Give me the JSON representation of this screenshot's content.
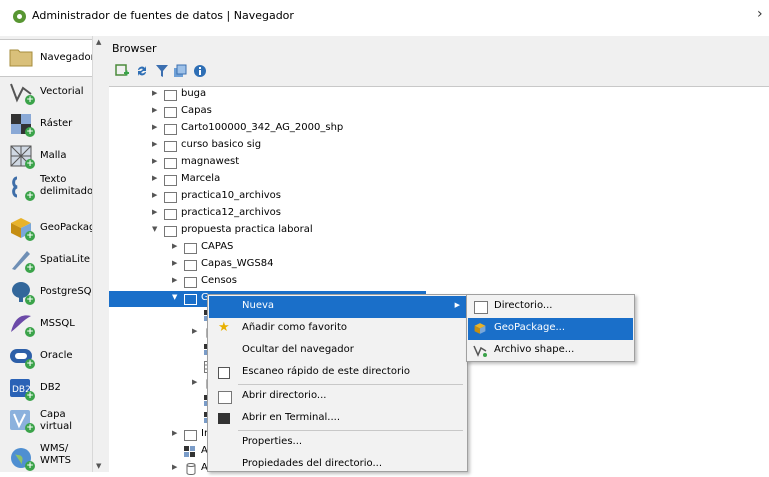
{
  "window": {
    "title": "Administrador de fuentes de datos | Navegador"
  },
  "sidebar": {
    "items": [
      {
        "label": "Navegador"
      },
      {
        "label": "Vectorial"
      },
      {
        "label": "Ráster"
      },
      {
        "label": "Malla"
      },
      {
        "label": "Texto\ndelimitado"
      },
      {
        "label": "GeoPackage"
      },
      {
        "label": "SpatiaLite"
      },
      {
        "label": "PostgreSQL"
      },
      {
        "label": "MSSQL"
      },
      {
        "label": "Oracle"
      },
      {
        "label": "DB2"
      },
      {
        "label": "Capa\nvirtual"
      },
      {
        "label": "WMS/\nWMTS"
      }
    ]
  },
  "browser": {
    "header": "Browser",
    "tree": [
      {
        "label": "buga"
      },
      {
        "label": "Capas"
      },
      {
        "label": "Carto100000_342_AG_2000_shp"
      },
      {
        "label": "curso basico sig"
      },
      {
        "label": "magnawest"
      },
      {
        "label": "Marcela"
      },
      {
        "label": "practica10_archivos"
      },
      {
        "label": "practica12_archivos"
      },
      {
        "label": "propuesta practica laboral"
      },
      {
        "label": "CAPAS"
      },
      {
        "label": "Capas_WGS84"
      },
      {
        "label": "Censos"
      },
      {
        "label": "Geodatabases"
      },
      {
        "label": "Im"
      },
      {
        "label": "Ac"
      },
      {
        "label": "Ac"
      }
    ]
  },
  "context_menu": {
    "items": [
      {
        "label": "Nueva"
      },
      {
        "label": "Añadir como favorito"
      },
      {
        "label": "Ocultar del navegador"
      },
      {
        "label": "Escaneo rápido de este directorio"
      },
      {
        "label": "Abrir directorio..."
      },
      {
        "label": "Abrir en Terminal...."
      },
      {
        "label": "Properties..."
      },
      {
        "label": "Propiedades del directorio..."
      }
    ]
  },
  "submenu": {
    "items": [
      {
        "label": "Directorio..."
      },
      {
        "label": "GeoPackage..."
      },
      {
        "label": "Archivo shape..."
      }
    ]
  },
  "colors": {
    "selection": "#1a6fc9",
    "qgis_green": "#589632"
  }
}
